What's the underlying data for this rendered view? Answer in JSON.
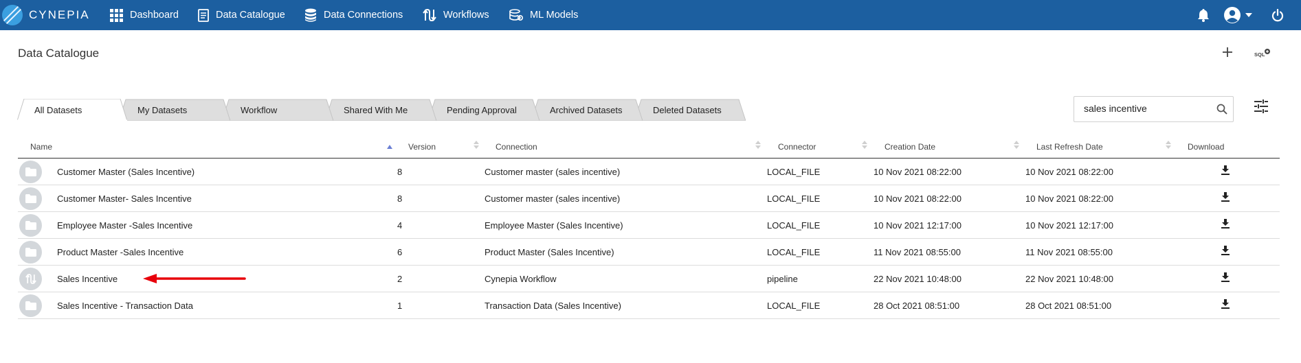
{
  "app": {
    "name": "CYNEPIA"
  },
  "nav": {
    "items": [
      {
        "label": "Dashboard",
        "icon": "grid-icon"
      },
      {
        "label": "Data Catalogue",
        "icon": "document-icon"
      },
      {
        "label": "Data Connections",
        "icon": "database-icon"
      },
      {
        "label": "Workflows",
        "icon": "workflow-icon"
      },
      {
        "label": "ML Models",
        "icon": "ml-models-icon"
      }
    ],
    "right_icons": [
      "bell-icon",
      "user-avatar-icon",
      "chevron-down-icon",
      "power-icon"
    ]
  },
  "page": {
    "title": "Data Catalogue",
    "actions": {
      "add_icon": "plus-icon",
      "sql_icon": "sql-icon",
      "sql_label": "SQL"
    }
  },
  "tabs": [
    {
      "label": "All Datasets",
      "active": true
    },
    {
      "label": "My Datasets",
      "active": false
    },
    {
      "label": "Workflow",
      "active": false
    },
    {
      "label": "Shared With Me",
      "active": false
    },
    {
      "label": "Pending Approval",
      "active": false
    },
    {
      "label": "Archived Datasets",
      "active": false
    },
    {
      "label": "Deleted Datasets",
      "active": false
    }
  ],
  "search": {
    "value": "sales incentive",
    "icon": "search-icon"
  },
  "filter": {
    "icon": "filter-sliders-icon"
  },
  "table": {
    "columns": [
      "Name",
      "Version",
      "Connection",
      "Connector",
      "Creation Date",
      "Last Refresh Date",
      "Download"
    ],
    "rows": [
      {
        "icon": "folder-icon",
        "name": "Customer Master (Sales Incentive)",
        "version": "8",
        "connection": "Customer master (sales incentive)",
        "connector": "LOCAL_FILE",
        "created": "10 Nov 2021 08:22:00",
        "refreshed": "10 Nov 2021 08:22:00"
      },
      {
        "icon": "folder-icon",
        "name": "Customer Master- Sales Incentive",
        "version": "8",
        "connection": "Customer master (sales incentive)",
        "connector": "LOCAL_FILE",
        "created": "10 Nov 2021 08:22:00",
        "refreshed": "10 Nov 2021 08:22:00"
      },
      {
        "icon": "folder-icon",
        "name": "Employee Master -Sales Incentive",
        "version": "4",
        "connection": "Employee Master (Sales Incentive)",
        "connector": "LOCAL_FILE",
        "created": "10 Nov 2021 12:17:00",
        "refreshed": "10 Nov 2021 12:17:00"
      },
      {
        "icon": "folder-icon",
        "name": "Product Master -Sales Incentive",
        "version": "6",
        "connection": "Product Master (Sales Incentive)",
        "connector": "LOCAL_FILE",
        "created": "11 Nov 2021 08:55:00",
        "refreshed": "11 Nov 2021 08:55:00"
      },
      {
        "icon": "workflow-icon",
        "name": "Sales Incentive",
        "version": "2",
        "connection": "Cynepia Workflow",
        "connector": "pipeline",
        "created": "22 Nov 2021 10:48:00",
        "refreshed": "22 Nov 2021 10:48:00"
      },
      {
        "icon": "folder-icon",
        "name": "Sales Incentive - Transaction Data",
        "version": "1",
        "connection": "Transaction Data (Sales Incentive)",
        "connector": "LOCAL_FILE",
        "created": "28 Oct 2021 08:51:00",
        "refreshed": "28 Oct 2021 08:51:00"
      }
    ]
  },
  "colors": {
    "navbar": "#1c5fa0",
    "annotation_arrow": "#e8000b",
    "row_icon_bg": "#d3d7db",
    "tab_inactive": "#dedede"
  }
}
